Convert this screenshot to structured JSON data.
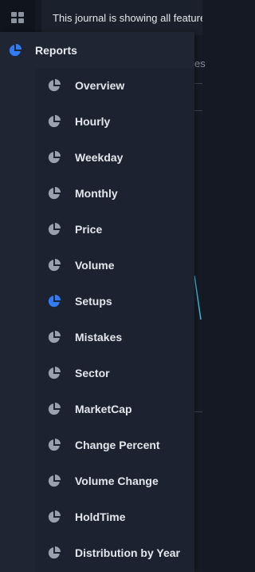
{
  "banner": {
    "text": "This journal is showing all features"
  },
  "background": {
    "fragment": "es"
  },
  "rail": {
    "items": [
      {
        "icon": "grid-icon"
      },
      {
        "icon": "pie-chart-icon",
        "active": true
      },
      {
        "icon": "transfer-arrows-icon"
      },
      {
        "icon": "sliders-icon"
      }
    ]
  },
  "flyout": {
    "title": "Reports",
    "items": [
      {
        "label": "Overview",
        "active": false
      },
      {
        "label": "Hourly",
        "active": false
      },
      {
        "label": "Weekday",
        "active": false
      },
      {
        "label": "Monthly",
        "active": false
      },
      {
        "label": "Price",
        "active": false
      },
      {
        "label": "Volume",
        "active": false
      },
      {
        "label": "Setups",
        "active": true
      },
      {
        "label": "Mistakes",
        "active": false
      },
      {
        "label": "Sector",
        "active": false
      },
      {
        "label": "MarketCap",
        "active": false
      },
      {
        "label": "Change Percent",
        "active": false
      },
      {
        "label": "Volume Change",
        "active": false
      },
      {
        "label": "HoldTime",
        "active": false
      },
      {
        "label": "Distribution by Year",
        "active": false
      }
    ]
  },
  "colors": {
    "accent": "#2f7cf6",
    "icon_inactive": "#9aa1ad",
    "icon_rail": "#8c93a0"
  }
}
